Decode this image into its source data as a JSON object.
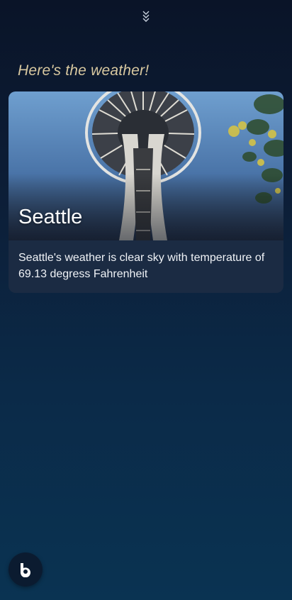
{
  "header": {
    "collapse_icon": "double-chevron-down-icon"
  },
  "greeting": "Here's the weather!",
  "weather_card": {
    "city": "Seattle",
    "description": "Seattle's weather is clear sky with temperature of 69.13 degress Fahrenheit",
    "image": "space-needle-photo"
  },
  "assistant_button": {
    "icon": "bixby-icon"
  },
  "colors": {
    "greeting": "#d8c8a0",
    "card_background": "#1b2b43",
    "background_top": "#0a1428",
    "background_bottom": "#0a3352"
  }
}
